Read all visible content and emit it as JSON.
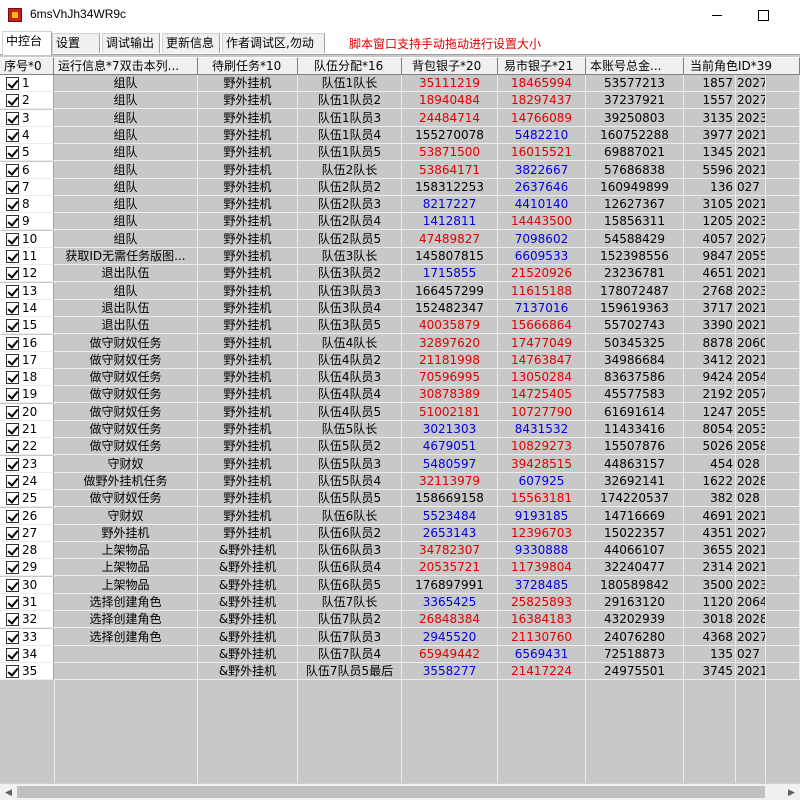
{
  "window": {
    "title": "6msVhJh34WR9c"
  },
  "tabs": [
    {
      "label": "中控台"
    },
    {
      "label": "设置"
    },
    {
      "label": "调试输出"
    },
    {
      "label": "更新信息"
    },
    {
      "label": "作者调试区,勿动"
    }
  ],
  "notice": "脚本窗口支持手动拖动进行设置大小",
  "colors": {
    "red_value": "#e00000",
    "blue_value": "#0000e0",
    "grid_bg": "#c8c8c8"
  },
  "icons": {
    "app": "app-icon",
    "minimize": "minimize-icon",
    "maximize": "maximize-icon",
    "checkbox": "checkbox-checked-icon"
  },
  "table": {
    "headers": [
      "序号*0",
      "运行信息*7双击本列...",
      "待刷任务*10",
      "队伍分配*16",
      "背包银子*20",
      "易市银子*21",
      "本账号总金...",
      "当前角色ID*39"
    ],
    "rows": [
      {
        "id": "1",
        "status": "组队",
        "task": "野外挂机",
        "team": "队伍1队长",
        "bag": "35111219",
        "bag_color": "red",
        "market": "18465994",
        "market_color": "red",
        "total": "53577213",
        "char_id": "1857",
        "extra": "2027"
      },
      {
        "id": "2",
        "status": "组队",
        "task": "野外挂机",
        "team": "队伍1队员2",
        "bag": "18940484",
        "bag_color": "red",
        "market": "18297437",
        "market_color": "red",
        "total": "37237921",
        "char_id": "1557",
        "extra": "2027"
      },
      {
        "id": "3",
        "status": "组队",
        "task": "野外挂机",
        "team": "队伍1队员3",
        "bag": "24484714",
        "bag_color": "red",
        "market": "14766089",
        "market_color": "red",
        "total": "39250803",
        "char_id": "3135",
        "extra": "2023"
      },
      {
        "id": "4",
        "status": "组队",
        "task": "野外挂机",
        "team": "队伍1队员4",
        "bag": "155270078",
        "bag_color": "black",
        "market": "5482210",
        "market_color": "blue",
        "total": "160752288",
        "char_id": "3977",
        "extra": "2021"
      },
      {
        "id": "5",
        "status": "组队",
        "task": "野外挂机",
        "team": "队伍1队员5",
        "bag": "53871500",
        "bag_color": "red",
        "market": "16015521",
        "market_color": "red",
        "total": "69887021",
        "char_id": "1345",
        "extra": "2021"
      },
      {
        "id": "6",
        "status": "组队",
        "task": "野外挂机",
        "team": "队伍2队长",
        "bag": "53864171",
        "bag_color": "red",
        "market": "3822667",
        "market_color": "blue",
        "total": "57686838",
        "char_id": "5596",
        "extra": "2021"
      },
      {
        "id": "7",
        "status": "组队",
        "task": "野外挂机",
        "team": "队伍2队员2",
        "bag": "158312253",
        "bag_color": "black",
        "market": "2637646",
        "market_color": "blue",
        "total": "160949899",
        "char_id": "136",
        "extra": "027"
      },
      {
        "id": "8",
        "status": "组队",
        "task": "野外挂机",
        "team": "队伍2队员3",
        "bag": "8217227",
        "bag_color": "blue",
        "market": "4410140",
        "market_color": "blue",
        "total": "12627367",
        "char_id": "3105",
        "extra": "2021"
      },
      {
        "id": "9",
        "status": "组队",
        "task": "野外挂机",
        "team": "队伍2队员4",
        "bag": "1412811",
        "bag_color": "blue",
        "market": "14443500",
        "market_color": "red",
        "total": "15856311",
        "char_id": "1205",
        "extra": "2023"
      },
      {
        "id": "10",
        "status": "组队",
        "task": "野外挂机",
        "team": "队伍2队员5",
        "bag": "47489827",
        "bag_color": "red",
        "market": "7098602",
        "market_color": "blue",
        "total": "54588429",
        "char_id": "4057",
        "extra": "2027"
      },
      {
        "id": "11",
        "status": "获取ID无需任务版图...",
        "task": "野外挂机",
        "team": "队伍3队长",
        "bag": "145807815",
        "bag_color": "black",
        "market": "6609533",
        "market_color": "blue",
        "total": "152398556",
        "char_id": "9847",
        "extra": "2055"
      },
      {
        "id": "12",
        "status": "退出队伍",
        "task": "野外挂机",
        "team": "队伍3队员2",
        "bag": "1715855",
        "bag_color": "blue",
        "market": "21520926",
        "market_color": "red",
        "total": "23236781",
        "char_id": "4651",
        "extra": "2021"
      },
      {
        "id": "13",
        "status": "组队",
        "task": "野外挂机",
        "team": "队伍3队员3",
        "bag": "166457299",
        "bag_color": "black",
        "market": "11615188",
        "market_color": "red",
        "total": "178072487",
        "char_id": "2768",
        "extra": "2023"
      },
      {
        "id": "14",
        "status": "退出队伍",
        "task": "野外挂机",
        "team": "队伍3队员4",
        "bag": "152482347",
        "bag_color": "black",
        "market": "7137016",
        "market_color": "blue",
        "total": "159619363",
        "char_id": "3717",
        "extra": "2021"
      },
      {
        "id": "15",
        "status": "退出队伍",
        "task": "野外挂机",
        "team": "队伍3队员5",
        "bag": "40035879",
        "bag_color": "red",
        "market": "15666864",
        "market_color": "red",
        "total": "55702743",
        "char_id": "3390",
        "extra": "2021"
      },
      {
        "id": "16",
        "status": "做守财奴任务",
        "task": "野外挂机",
        "team": "队伍4队长",
        "bag": "32897620",
        "bag_color": "red",
        "market": "17477049",
        "market_color": "red",
        "total": "50345325",
        "char_id": "8878",
        "extra": "2060"
      },
      {
        "id": "17",
        "status": "做守财奴任务",
        "task": "野外挂机",
        "team": "队伍4队员2",
        "bag": "21181998",
        "bag_color": "red",
        "market": "14763847",
        "market_color": "red",
        "total": "34986684",
        "char_id": "3412",
        "extra": "2021"
      },
      {
        "id": "18",
        "status": "做守财奴任务",
        "task": "野外挂机",
        "team": "队伍4队员3",
        "bag": "70596995",
        "bag_color": "red",
        "market": "13050284",
        "market_color": "red",
        "total": "83637586",
        "char_id": "9424",
        "extra": "2054"
      },
      {
        "id": "19",
        "status": "做守财奴任务",
        "task": "野外挂机",
        "team": "队伍4队员4",
        "bag": "30878389",
        "bag_color": "red",
        "market": "14725405",
        "market_color": "red",
        "total": "45577583",
        "char_id": "2192",
        "extra": "2057"
      },
      {
        "id": "20",
        "status": "做守财奴任务",
        "task": "野外挂机",
        "team": "队伍4队员5",
        "bag": "51002181",
        "bag_color": "red",
        "market": "10727790",
        "market_color": "red",
        "total": "61691614",
        "char_id": "1247",
        "extra": "2055"
      },
      {
        "id": "21",
        "status": "做守财奴任务",
        "task": "野外挂机",
        "team": "队伍5队长",
        "bag": "3021303",
        "bag_color": "blue",
        "market": "8431532",
        "market_color": "blue",
        "total": "11433416",
        "char_id": "8054",
        "extra": "2053"
      },
      {
        "id": "22",
        "status": "做守财奴任务",
        "task": "野外挂机",
        "team": "队伍5队员2",
        "bag": "4679051",
        "bag_color": "blue",
        "market": "10829273",
        "market_color": "red",
        "total": "15507876",
        "char_id": "5026",
        "extra": "2058"
      },
      {
        "id": "23",
        "status": "守财奴",
        "task": "野外挂机",
        "team": "队伍5队员3",
        "bag": "5480597",
        "bag_color": "blue",
        "market": "39428515",
        "market_color": "red",
        "total": "44863157",
        "char_id": "454",
        "extra": "028"
      },
      {
        "id": "24",
        "status": "做野外挂机任务",
        "task": "野外挂机",
        "team": "队伍5队员4",
        "bag": "32113979",
        "bag_color": "red",
        "market": "607925",
        "market_color": "blue",
        "total": "32692141",
        "char_id": "1622",
        "extra": "2028"
      },
      {
        "id": "25",
        "status": "做守财奴任务",
        "task": "野外挂机",
        "team": "队伍5队员5",
        "bag": "158669158",
        "bag_color": "black",
        "market": "15563181",
        "market_color": "red",
        "total": "174220537",
        "char_id": "382",
        "extra": "028"
      },
      {
        "id": "26",
        "status": "守财奴",
        "task": "野外挂机",
        "team": "队伍6队长",
        "bag": "5523484",
        "bag_color": "blue",
        "market": "9193185",
        "market_color": "blue",
        "total": "14716669",
        "char_id": "4691",
        "extra": "2021"
      },
      {
        "id": "27",
        "status": "野外挂机",
        "task": "野外挂机",
        "team": "队伍6队员2",
        "bag": "2653143",
        "bag_color": "blue",
        "market": "12396703",
        "market_color": "red",
        "total": "15022357",
        "char_id": "4351",
        "extra": "2027"
      },
      {
        "id": "28",
        "status": "上架物品",
        "task": "&野外挂机",
        "team": "队伍6队员3",
        "bag": "34782307",
        "bag_color": "red",
        "market": "9330888",
        "market_color": "blue",
        "total": "44066107",
        "char_id": "3655",
        "extra": "2021"
      },
      {
        "id": "29",
        "status": "上架物品",
        "task": "&野外挂机",
        "team": "队伍6队员4",
        "bag": "20535721",
        "bag_color": "red",
        "market": "11739804",
        "market_color": "red",
        "total": "32240477",
        "char_id": "2314",
        "extra": "2021"
      },
      {
        "id": "30",
        "status": "上架物品",
        "task": "&野外挂机",
        "team": "队伍6队员5",
        "bag": "176897991",
        "bag_color": "black",
        "market": "3728485",
        "market_color": "blue",
        "total": "180589842",
        "char_id": "3500",
        "extra": "2023"
      },
      {
        "id": "31",
        "status": "选择创建角色",
        "task": "&野外挂机",
        "team": "队伍7队长",
        "bag": "3365425",
        "bag_color": "blue",
        "market": "25825893",
        "market_color": "red",
        "total": "29163120",
        "char_id": "1120",
        "extra": "2064"
      },
      {
        "id": "32",
        "status": "选择创建角色",
        "task": "&野外挂机",
        "team": "队伍7队员2",
        "bag": "26848384",
        "bag_color": "red",
        "market": "16384183",
        "market_color": "red",
        "total": "43202939",
        "char_id": "3018",
        "extra": "2028"
      },
      {
        "id": "33",
        "status": "选择创建角色",
        "task": "&野外挂机",
        "team": "队伍7队员3",
        "bag": "2945520",
        "bag_color": "blue",
        "market": "21130760",
        "market_color": "red",
        "total": "24076280",
        "char_id": "4368",
        "extra": "2027"
      },
      {
        "id": "34",
        "status": "",
        "task": "&野外挂机",
        "team": "队伍7队员4",
        "bag": "65949442",
        "bag_color": "red",
        "market": "6569431",
        "market_color": "blue",
        "total": "72518873",
        "char_id": "135",
        "extra": "027"
      },
      {
        "id": "35",
        "status": "",
        "task": "&野外挂机",
        "team": "队伍7队员5最后",
        "bag": "3558277",
        "bag_color": "blue",
        "market": "21417224",
        "market_color": "red",
        "total": "24975501",
        "char_id": "3745",
        "extra": "2021"
      }
    ]
  }
}
